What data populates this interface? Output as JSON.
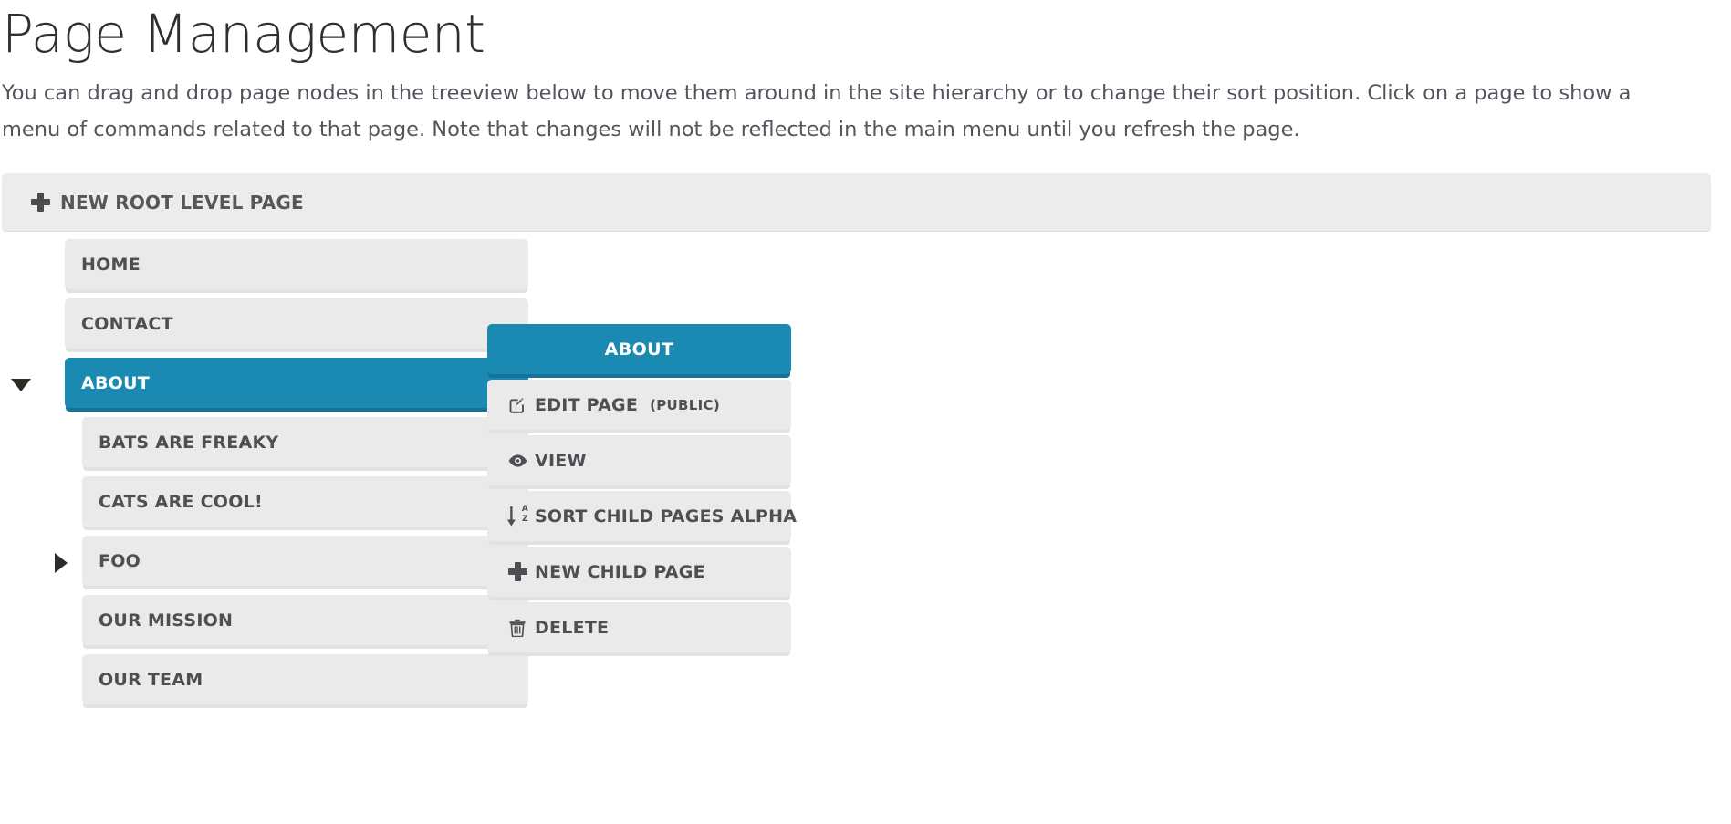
{
  "header": {
    "title": "Page Management",
    "description": "You can drag and drop page nodes in the treeview below to move them around in the site hierarchy or to change their sort position. Click on a page to show a menu of commands related to that page. Note that changes will not be reflected in the main menu until you refresh the page."
  },
  "toolbar": {
    "new_root_label": "NEW ROOT LEVEL PAGE",
    "new_root_icon": "plus-icon"
  },
  "tree": {
    "nodes": [
      {
        "label": "HOME",
        "level": 0,
        "selected": false,
        "toggle": "none"
      },
      {
        "label": "CONTACT",
        "level": 0,
        "selected": false,
        "toggle": "none"
      },
      {
        "label": "ABOUT",
        "level": 0,
        "selected": true,
        "toggle": "expanded"
      }
    ],
    "children": [
      {
        "label": "BATS ARE FREAKY",
        "level": 1,
        "selected": false,
        "toggle": "none"
      },
      {
        "label": "CATS ARE COOL!",
        "level": 1,
        "selected": false,
        "toggle": "none"
      },
      {
        "label": "FOO",
        "level": 1,
        "selected": false,
        "toggle": "collapsed"
      },
      {
        "label": "OUR MISSION",
        "level": 1,
        "selected": false,
        "toggle": "none"
      },
      {
        "label": "OUR TEAM",
        "level": 1,
        "selected": false,
        "toggle": "none"
      }
    ]
  },
  "context_menu": {
    "header": "ABOUT",
    "items": [
      {
        "label": "EDIT PAGE",
        "sub": "(PUBLIC)",
        "icon": "edit-pencil-square-icon"
      },
      {
        "label": "VIEW",
        "sub": "",
        "icon": "eye-icon"
      },
      {
        "label": "SORT CHILD PAGES ALPHA",
        "sub": "",
        "icon": "sort-alpha-down-icon"
      },
      {
        "label": "NEW CHILD PAGE",
        "sub": "",
        "icon": "plus-icon"
      },
      {
        "label": "DELETE",
        "sub": "",
        "icon": "trash-icon"
      }
    ]
  },
  "colors": {
    "accent_blue": "#1b8ab3",
    "accent_blue_shadow": "#15739a",
    "node_grey": "#eaeaea",
    "toolbar_grey": "#ececec",
    "text_grey": "#4e4f52",
    "body_text": "#53565c",
    "title_text": "#2f2f2f"
  }
}
